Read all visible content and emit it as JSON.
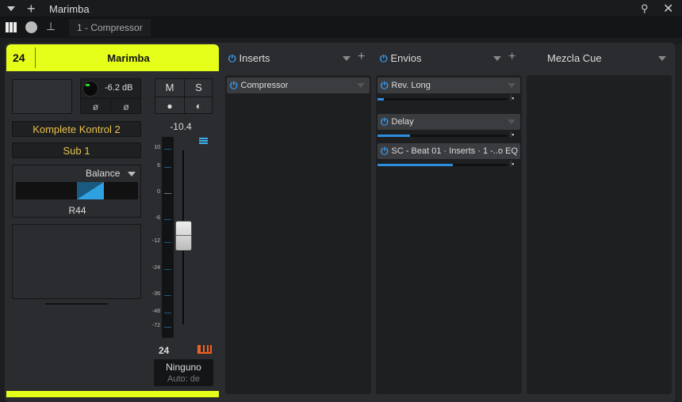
{
  "window": {
    "title": "Marimba"
  },
  "toolbar": {
    "breadcrumb": "1 - Compressor"
  },
  "channel": {
    "number": "24",
    "name": "Marimba",
    "send_level": "-6.2 dB",
    "mute": "M",
    "solo": "S",
    "input": "Komplete Kontrol 2",
    "output": "Sub 1",
    "pan_mode": "Balance",
    "pan_value": "R44",
    "fader_value": "-10.4",
    "fader_db": -10.4,
    "meter_ticks": [
      "10",
      "6",
      "0",
      "-6",
      "-12",
      "-24",
      "-36",
      "-48",
      "-72"
    ],
    "footer_number": "24",
    "automation_mode": "Ninguno",
    "automation_label": "Auto: de",
    "accent": "#e6ff1a"
  },
  "inserts": {
    "title": "Inserts",
    "items": [
      {
        "name": "Compressor"
      }
    ]
  },
  "sends": {
    "title": "Envios",
    "items": [
      {
        "name": "Rev. Long",
        "level": 0.05
      },
      {
        "name": "Delay",
        "level": 0.25
      },
      {
        "name": "SC - Beat 01 · Inserts · 1 -..o EQ",
        "level": 0.58
      }
    ]
  },
  "cue": {
    "title": "Mezcla Cue"
  }
}
